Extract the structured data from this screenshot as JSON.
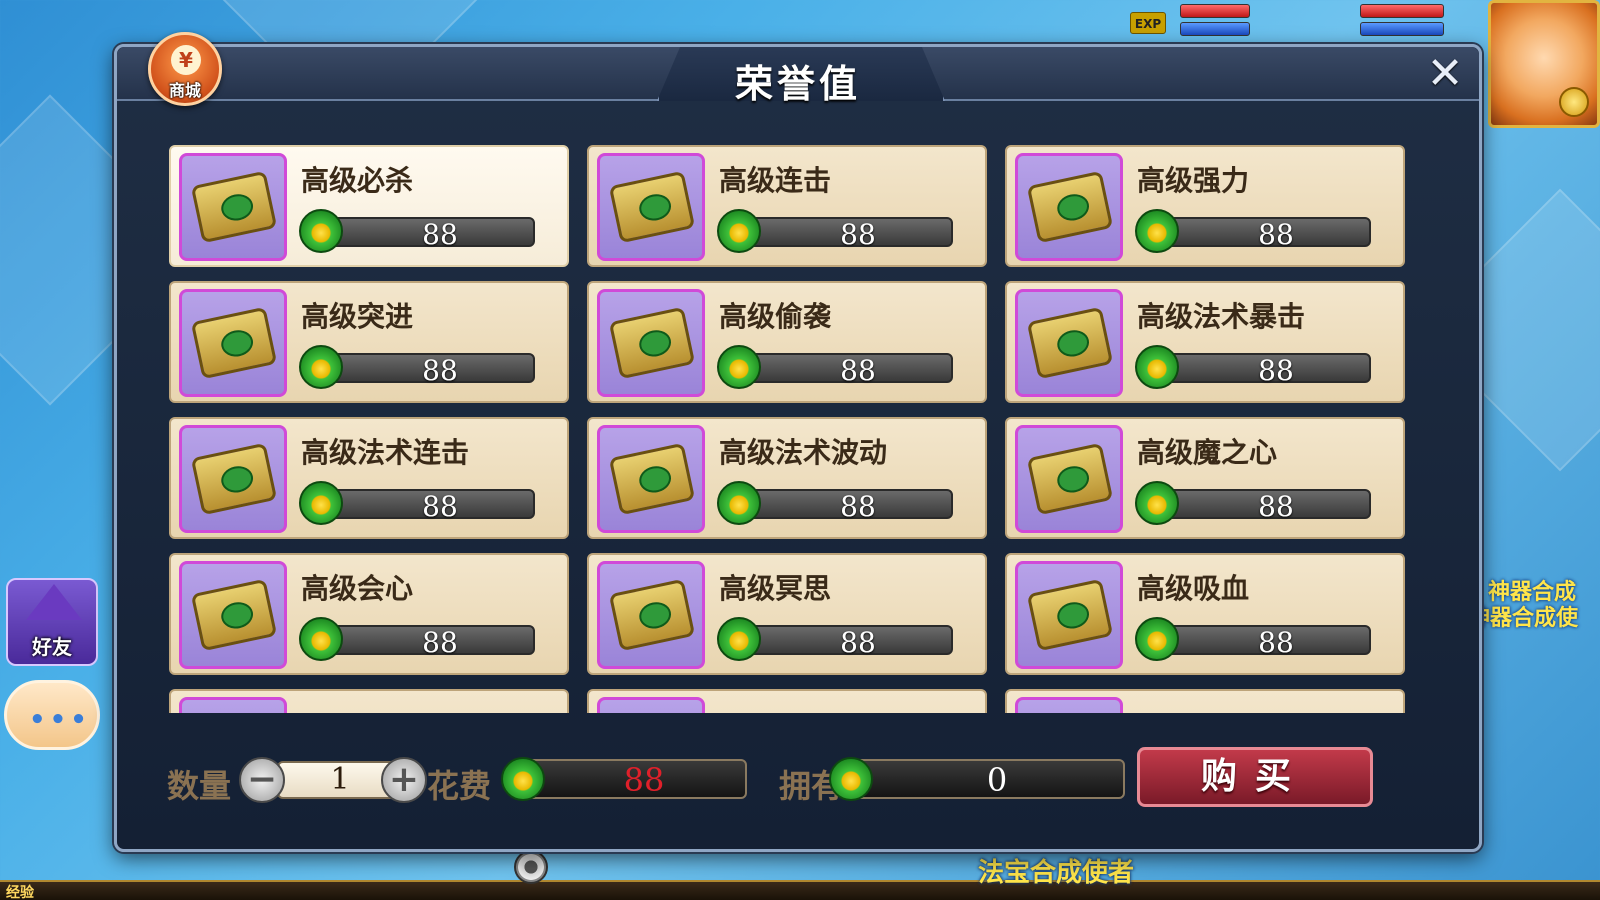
{
  "hud": {
    "exp_badge": "EXP",
    "exp_label": "经验",
    "friend_label": "好友",
    "chat_dots": "•••",
    "shop_label": "商城",
    "shop_symbol": "¥",
    "side_text_1": "神器合成",
    "side_text_2": "神器合成使",
    "npc_text": "法宝合成使者"
  },
  "modal": {
    "title": "荣誉值",
    "close_symbol": "✕"
  },
  "items": [
    {
      "name": "高级必杀",
      "price": "88"
    },
    {
      "name": "高级连击",
      "price": "88"
    },
    {
      "name": "高级强力",
      "price": "88"
    },
    {
      "name": "高级突进",
      "price": "88"
    },
    {
      "name": "高级偷袭",
      "price": "88"
    },
    {
      "name": "高级法术暴击",
      "price": "88"
    },
    {
      "name": "高级法术连击",
      "price": "88"
    },
    {
      "name": "高级法术波动",
      "price": "88"
    },
    {
      "name": "高级魔之心",
      "price": "88"
    },
    {
      "name": "高级会心",
      "price": "88"
    },
    {
      "name": "高级冥思",
      "price": "88"
    },
    {
      "name": "高级吸血",
      "price": "88"
    },
    {
      "name": "",
      "price": ""
    },
    {
      "name": "",
      "price": ""
    },
    {
      "name": "",
      "price": ""
    }
  ],
  "footer": {
    "quantity_label": "数量",
    "quantity_value": "1",
    "minus_symbol": "−",
    "plus_symbol": "+",
    "cost_label": "花费",
    "cost_value": "88",
    "owned_label": "拥有",
    "owned_value": "0",
    "buy_label": "购买"
  },
  "colors": {
    "cost_value": "#e0202a",
    "owned_value": "#ffffff",
    "accent_frame": "#d04ad8"
  },
  "icons": {
    "item": "skill-scroll-icon",
    "currency": "honor-gem-icon",
    "close": "close-icon",
    "settings": "gear-icon"
  }
}
